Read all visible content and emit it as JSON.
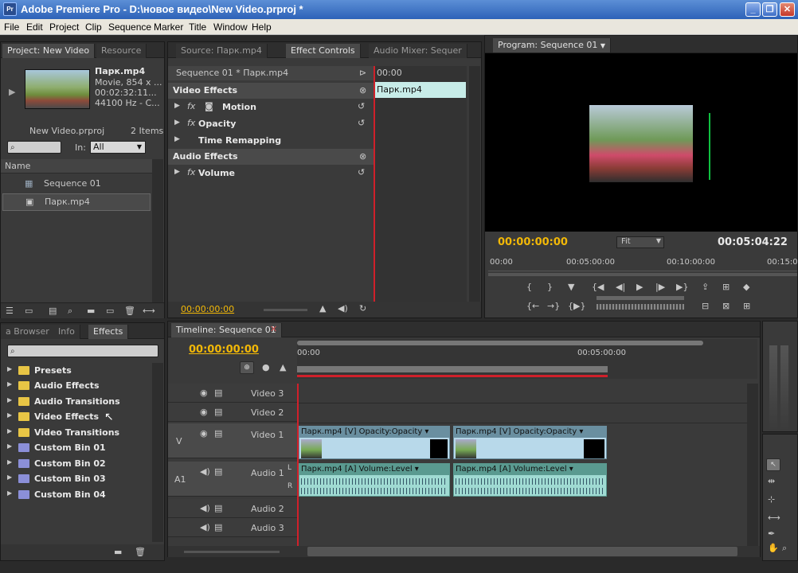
{
  "app": {
    "title": "Adobe Premiere Pro - D:\\новое видео\\New Video.prproj *",
    "icon_label": "Pr"
  },
  "menu": [
    "File",
    "Edit",
    "Project",
    "Clip",
    "Sequence",
    "Marker",
    "Title",
    "Window",
    "Help"
  ],
  "project": {
    "tabs": [
      "Project: New Video",
      "Resource"
    ],
    "clip_name": "Парк.mp4",
    "clip_info": [
      "Movie, 854 x ...",
      "00:02:32:11...",
      "44100 Hz - C..."
    ],
    "project_file": "New Video.prproj",
    "item_count": "2 Items",
    "in_label": "In:",
    "in_value": "All",
    "name_header": "Name",
    "items": [
      "Sequence 01",
      "Парк.mp4"
    ]
  },
  "effect_controls": {
    "tabs": [
      "Source: Парк.mp4",
      "Effect Controls",
      "Audio Mixer: Sequer"
    ],
    "sequence_label": "Sequence 01 * Парк.mp4",
    "video_effects": "Video Effects",
    "effects": [
      "Motion",
      "Opacity",
      "Time Remapping"
    ],
    "audio_effects": "Audio Effects",
    "audio_items": [
      "Volume"
    ],
    "fx": "fx",
    "ruler_time": "00:00",
    "clip_label": "Парк.mp4",
    "timecode": "00:00:00:00"
  },
  "program": {
    "tab": "Program: Sequence 01",
    "timecode": "00:00:00:00",
    "fit": "Fit",
    "duration": "00:05:04:22",
    "ruler": [
      "00:00",
      "00:05:00:00",
      "00:10:00:00",
      "00:15:0"
    ]
  },
  "effects_panel": {
    "tabs": [
      "a Browser",
      "Info",
      "Effects"
    ],
    "folders": [
      "Presets",
      "Audio Effects",
      "Audio Transitions",
      "Video Effects",
      "Video Transitions"
    ],
    "bins": [
      "Custom Bin 01",
      "Custom Bin 02",
      "Custom Bin 03",
      "Custom Bin 04"
    ]
  },
  "timeline": {
    "tab": "Timeline: Sequence 01",
    "timecode": "00:00:00:00",
    "ruler": [
      "00:00",
      "00:05:00:00"
    ],
    "tracks": [
      "Video 3",
      "Video 2",
      "Video 1",
      "Audio 1",
      "Audio 2",
      "Audio 3"
    ],
    "v_label": "V",
    "a_label": "A1",
    "video_clips": [
      "Парк.mp4 [V]  Opacity:Opacity ▾",
      "Парк.mp4 [V]  Opacity:Opacity ▾"
    ],
    "audio_clips": [
      "Парк.mp4 [A]  Volume:Level ▾",
      "Парк.mp4 [A]  Volume:Level ▾"
    ],
    "lr": [
      "L",
      "R"
    ]
  },
  "colors": {
    "timecode": "#f2b807",
    "playhead": "#d0202a",
    "video_clip": "#b8d9ea",
    "audio_clip": "#9fdad2"
  }
}
